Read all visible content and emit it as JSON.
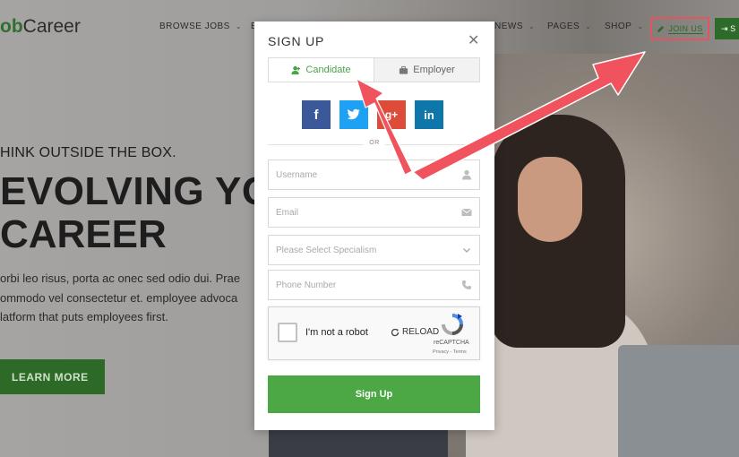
{
  "site": {
    "logo_prefix": "ob",
    "logo_suffix": "Career",
    "nav": [
      {
        "label": "BROWSE JOBS",
        "caret": true
      },
      {
        "label": "E",
        "caret": false
      },
      {
        "label": "NEWS",
        "caret": true
      },
      {
        "label": "PAGES",
        "caret": true
      },
      {
        "label": "SHOP",
        "caret": true
      }
    ],
    "join_us": "JOIN US",
    "signin": "S",
    "hero": {
      "kicker": "HINK OUTSIDE THE BOX.",
      "title_line1": "EVOLVING YO",
      "title_line2": "CAREER",
      "text_lines": [
        "orbi leo risus, porta ac onec sed odio dui. Prae",
        "ommodo vel consectetur et.  employee advoca",
        "latform that puts employees first."
      ],
      "button": "LEARN MORE"
    }
  },
  "modal": {
    "title": "SIGN UP",
    "close": "✕",
    "tabs": [
      {
        "label": "Candidate",
        "icon": "add-user-icon",
        "active": true
      },
      {
        "label": "Employer",
        "icon": "briefcase-icon",
        "active": false
      }
    ],
    "social": [
      {
        "name": "facebook",
        "glyph": "f",
        "color": "#3b5998"
      },
      {
        "name": "twitter",
        "glyph": "t",
        "color": "#1da1f2"
      },
      {
        "name": "google-plus",
        "glyph": "g+",
        "color": "#dd4b39"
      },
      {
        "name": "linkedin",
        "glyph": "in",
        "color": "#0e76a8"
      }
    ],
    "or": "OR",
    "fields": {
      "username_placeholder": "Username",
      "email_placeholder": "Email",
      "specialism_placeholder": "Please Select Specialism",
      "phone_placeholder": "Phone Number"
    },
    "captcha": {
      "label": "I'm not a robot",
      "reload": "RELOAD",
      "brand": "reCAPTCHA",
      "terms": "Privacy - Terms"
    },
    "submit": "Sign Up"
  },
  "colors": {
    "accent_green": "#4ba844",
    "annotation_red": "#f0525e"
  }
}
